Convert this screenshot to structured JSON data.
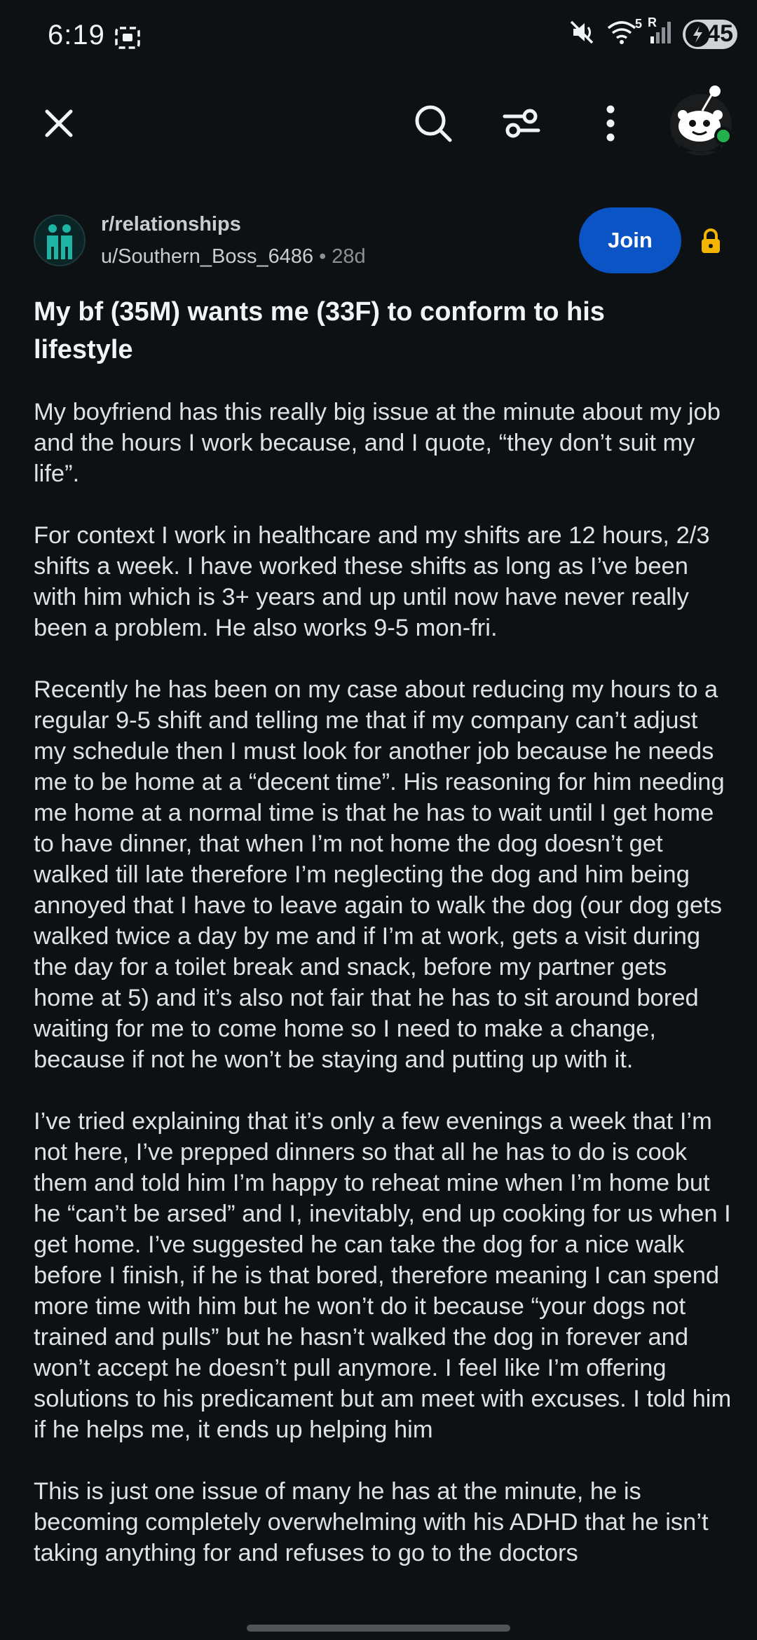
{
  "status_bar": {
    "time": "6:19",
    "battery": "45",
    "network_label": "5",
    "roaming_label": "R",
    "icons": [
      "screen-record-icon",
      "mute-icon",
      "wifi-icon",
      "signal-icon",
      "battery-icon"
    ]
  },
  "toolbar": {
    "icons": [
      "close-icon",
      "search-icon",
      "filter-icon",
      "more-vertical-icon",
      "user-avatar-icon"
    ],
    "online_color": "#22b14c"
  },
  "post": {
    "subreddit": "r/relationships",
    "author": "u/Southern_Boss_6486",
    "separator": "•",
    "age": "28d",
    "join_label": "Join",
    "join_color": "#0a54c6",
    "lock_color": "#f4b400",
    "title": "My bf (35M) wants me (33F) to conform to his lifestyle",
    "paragraphs": [
      "My boyfriend has this really big issue at the minute about my job and the hours I work because, and I quote, “they don’t suit my life”.",
      "For context I work in healthcare and my shifts are 12 hours, 2/3 shifts a week. I have worked these shifts as long as I’ve been with him which is 3+ years and up until now have never really been a problem. He also works 9-5 mon-fri.",
      "Recently he has been on my case about reducing my hours to a regular 9-5 shift and telling me that if my company can’t adjust my schedule then I must look for another job because he needs me to be home at a “decent time”. His reasoning for him needing me home at a normal time is that he has to wait until I get home to have dinner, that when I’m not home the dog doesn’t get walked till late therefore I’m neglecting the dog and him being annoyed that I have to leave again to walk the dog (our dog gets walked twice a day by me and if I’m at work, gets a visit during the day for a toilet break and snack, before my partner gets home at 5) and it’s also not fair that he has to sit around bored waiting for me to come home so I need to make a change, because if not he won’t be staying and putting up with it.",
      "I’ve tried explaining that it’s only a few evenings a week that I’m not here, I’ve prepped dinners so that all he has to do is cook them and told him I’m happy to reheat mine when I’m home but he “can’t be arsed” and I, inevitably, end up cooking for us when I get home. I’ve suggested he can take the dog for a nice walk before I finish, if he is that bored, therefore meaning I can spend more time with him but he won’t do it because “your dogs not trained and pulls” but he hasn’t walked the dog in forever and won’t accept he doesn’t pull anymore. I feel like I’m offering solutions to his predicament but am meet with excuses. I told him if he helps me, it ends up helping him",
      "This is just one issue of many he has at the minute, he is becoming completely overwhelming with his ADHD that he isn’t taking anything for and refuses to go to the doctors"
    ]
  }
}
